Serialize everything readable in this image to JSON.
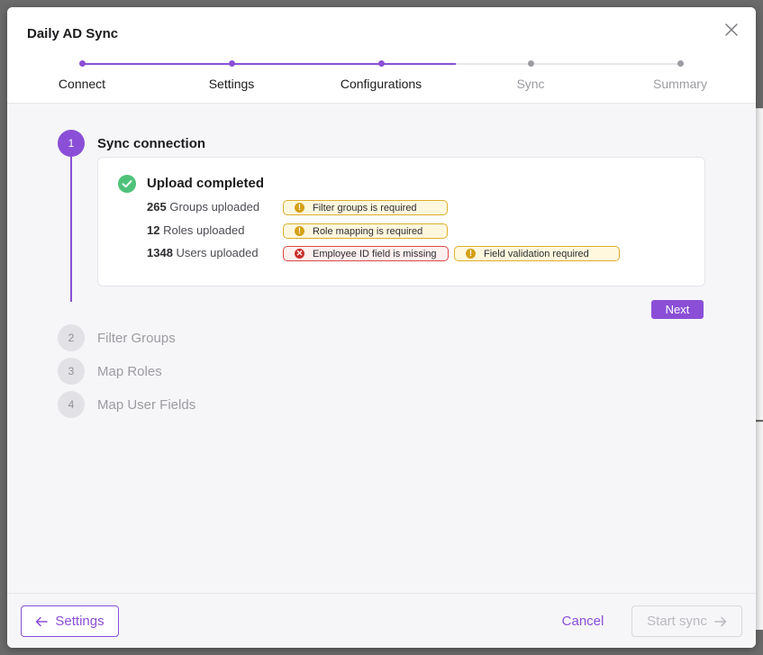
{
  "modal": {
    "title": "Daily AD Sync"
  },
  "stepper": {
    "steps": [
      {
        "label": "Connect",
        "state": "complete"
      },
      {
        "label": "Settings",
        "state": "complete"
      },
      {
        "label": "Configurations",
        "state": "current"
      },
      {
        "label": "Sync",
        "state": "pending"
      },
      {
        "label": "Summary",
        "state": "pending"
      }
    ]
  },
  "substeps": [
    {
      "number": "1",
      "title": "Sync connection",
      "state": "active"
    },
    {
      "number": "2",
      "title": "Filter Groups",
      "state": "inactive"
    },
    {
      "number": "3",
      "title": "Map Roles",
      "state": "inactive"
    },
    {
      "number": "4",
      "title": "Map User Fields",
      "state": "inactive"
    }
  ],
  "upload": {
    "title": "Upload completed",
    "status_icon": "check-circle-icon",
    "rows": [
      {
        "count": "265",
        "label": "Groups uploaded",
        "badges": [
          {
            "text": "Filter groups is required",
            "type": "warning",
            "icon": "exclamation-icon"
          }
        ]
      },
      {
        "count": "12",
        "label": "Roles uploaded",
        "badges": [
          {
            "text": "Role mapping is required",
            "type": "warning",
            "icon": "exclamation-icon"
          }
        ]
      },
      {
        "count": "1348",
        "label": "Users uploaded",
        "badges": [
          {
            "text": "Employee ID field is missing",
            "type": "error",
            "icon": "x-circle-icon"
          },
          {
            "text": "Field validation required",
            "type": "warning",
            "icon": "exclamation-icon"
          }
        ]
      }
    ]
  },
  "actions": {
    "next": "Next"
  },
  "footer": {
    "back": "Settings",
    "cancel": "Cancel",
    "start": "Start sync"
  },
  "colors": {
    "accent": "#8a4fd6",
    "success": "#4fc27a",
    "warning": "#d4a017",
    "error": "#c9302c"
  }
}
